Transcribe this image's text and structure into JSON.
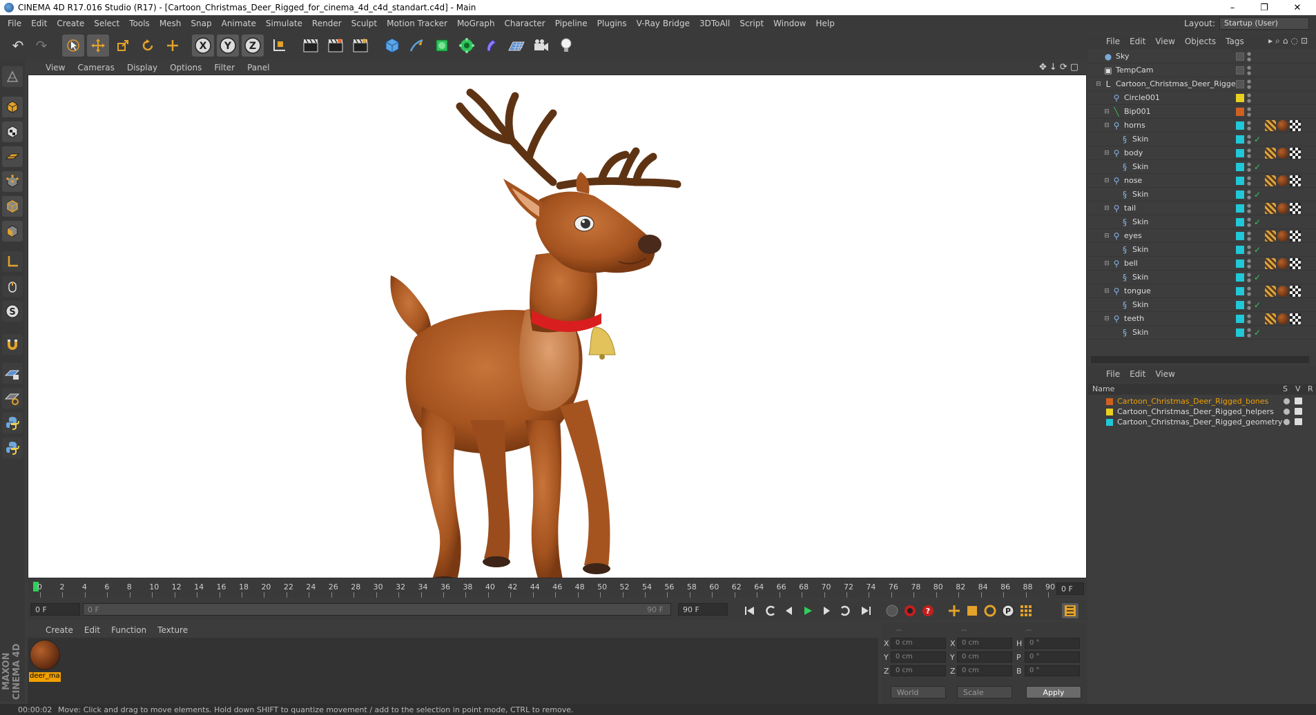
{
  "window": {
    "title": "CINEMA 4D R17.016 Studio (R17) - [Cartoon_Christmas_Deer_Rigged_for_cinema_4d_c4d_standart.c4d] - Main",
    "minimize": "–",
    "restore": "❐",
    "close": "✕"
  },
  "menubar": {
    "items": [
      "File",
      "Edit",
      "Create",
      "Select",
      "Tools",
      "Mesh",
      "Snap",
      "Animate",
      "Simulate",
      "Render",
      "Sculpt",
      "Motion Tracker",
      "MoGraph",
      "Character",
      "Pipeline",
      "Plugins",
      "V-Ray Bridge",
      "3DToAll",
      "Script",
      "Window",
      "Help"
    ],
    "layout_label": "Layout:",
    "layout_value": "Startup (User)"
  },
  "toolbar": {
    "undo": "↶",
    "redo": "↷",
    "x": "X",
    "y": "Y",
    "z": "Z"
  },
  "viewport": {
    "menu": [
      "View",
      "Cameras",
      "Display",
      "Options",
      "Filter",
      "Panel"
    ]
  },
  "timeline": {
    "ticks": [
      "0",
      "2",
      "4",
      "6",
      "8",
      "10",
      "12",
      "14",
      "16",
      "18",
      "20",
      "22",
      "24",
      "26",
      "28",
      "30",
      "32",
      "34",
      "36",
      "38",
      "40",
      "42",
      "44",
      "46",
      "48",
      "50",
      "52",
      "54",
      "56",
      "58",
      "60",
      "62",
      "64",
      "66",
      "68",
      "70",
      "72",
      "74",
      "76",
      "78",
      "80",
      "82",
      "84",
      "86",
      "88",
      "90"
    ],
    "current_frame": "0 F",
    "start_frame": "0 F",
    "range_start": "0 F",
    "range_end": "90 F",
    "end_frame": "90 F"
  },
  "material_manager": {
    "menu": [
      "Create",
      "Edit",
      "Function",
      "Texture"
    ],
    "material_name": "deer_ma"
  },
  "coordinates": {
    "header_dashes": [
      "--",
      "--",
      "--"
    ],
    "rows": [
      {
        "a_label": "X",
        "a_val": "0 cm",
        "b_label": "X",
        "b_val": "0 cm",
        "c_label": "H",
        "c_val": "0 °"
      },
      {
        "a_label": "Y",
        "a_val": "0 cm",
        "b_label": "Y",
        "b_val": "0 cm",
        "c_label": "P",
        "c_val": "0 °"
      },
      {
        "a_label": "Z",
        "a_val": "0 cm",
        "b_label": "Z",
        "b_val": "0 cm",
        "c_label": "B",
        "c_val": "0 °"
      }
    ],
    "space": "World",
    "mode": "Scale",
    "apply": "Apply"
  },
  "status": {
    "time": "00:00:02",
    "message": "Move: Click and drag to move elements. Hold down SHIFT to quantize movement / add to the selection in point mode, CTRL to remove."
  },
  "object_manager": {
    "menu": [
      "File",
      "Edit",
      "View",
      "Objects",
      "Tags"
    ],
    "objects": [
      {
        "name": "Sky",
        "depth": 0,
        "icon": "sky-icon",
        "swatch": "",
        "tags": 0
      },
      {
        "name": "TempCam",
        "depth": 0,
        "icon": "camera-icon",
        "swatch": "",
        "tags": 0
      },
      {
        "name": "Cartoon_Christmas_Deer_Rigged",
        "depth": 0,
        "icon": "null-icon",
        "swatch": "",
        "tags": 0
      },
      {
        "name": "Circle001",
        "depth": 1,
        "icon": "joint-icon",
        "swatch": "#e8d020",
        "tags": 0
      },
      {
        "name": "Bip001",
        "depth": 1,
        "icon": "bone-icon",
        "swatch": "#d06020",
        "tags": 0
      },
      {
        "name": "horns",
        "depth": 1,
        "icon": "joint-icon",
        "swatch": "#20c8d8",
        "tags": 3
      },
      {
        "name": "Skin",
        "depth": 2,
        "icon": "skin-icon",
        "swatch": "#20c8d8",
        "tags": 0
      },
      {
        "name": "body",
        "depth": 1,
        "icon": "joint-icon",
        "swatch": "#20c8d8",
        "tags": 3
      },
      {
        "name": "Skin",
        "depth": 2,
        "icon": "skin-icon",
        "swatch": "#20c8d8",
        "tags": 0
      },
      {
        "name": "nose",
        "depth": 1,
        "icon": "joint-icon",
        "swatch": "#20c8d8",
        "tags": 3
      },
      {
        "name": "Skin",
        "depth": 2,
        "icon": "skin-icon",
        "swatch": "#20c8d8",
        "tags": 0
      },
      {
        "name": "tail",
        "depth": 1,
        "icon": "joint-icon",
        "swatch": "#20c8d8",
        "tags": 3
      },
      {
        "name": "Skin",
        "depth": 2,
        "icon": "skin-icon",
        "swatch": "#20c8d8",
        "tags": 0
      },
      {
        "name": "eyes",
        "depth": 1,
        "icon": "joint-icon",
        "swatch": "#20c8d8",
        "tags": 3
      },
      {
        "name": "Skin",
        "depth": 2,
        "icon": "skin-icon",
        "swatch": "#20c8d8",
        "tags": 0
      },
      {
        "name": "bell",
        "depth": 1,
        "icon": "joint-icon",
        "swatch": "#20c8d8",
        "tags": 3
      },
      {
        "name": "Skin",
        "depth": 2,
        "icon": "skin-icon",
        "swatch": "#20c8d8",
        "tags": 0
      },
      {
        "name": "tongue",
        "depth": 1,
        "icon": "joint-icon",
        "swatch": "#20c8d8",
        "tags": 3
      },
      {
        "name": "Skin",
        "depth": 2,
        "icon": "skin-icon",
        "swatch": "#20c8d8",
        "tags": 0
      },
      {
        "name": "teeth",
        "depth": 1,
        "icon": "joint-icon",
        "swatch": "#20c8d8",
        "tags": 3
      },
      {
        "name": "Skin",
        "depth": 2,
        "icon": "skin-icon",
        "swatch": "#20c8d8",
        "tags": 0
      }
    ]
  },
  "layer_manager": {
    "menu": [
      "File",
      "Edit",
      "View"
    ],
    "header": {
      "name": "Name",
      "s": "S",
      "v": "V",
      "r": "R"
    },
    "layers": [
      {
        "name": "Cartoon_Christmas_Deer_Rigged_bones",
        "color": "#d06020",
        "selected": true
      },
      {
        "name": "Cartoon_Christmas_Deer_Rigged_helpers",
        "color": "#e8d020",
        "selected": false
      },
      {
        "name": "Cartoon_Christmas_Deer_Rigged_geometry",
        "color": "#20c8d8",
        "selected": false
      }
    ]
  }
}
